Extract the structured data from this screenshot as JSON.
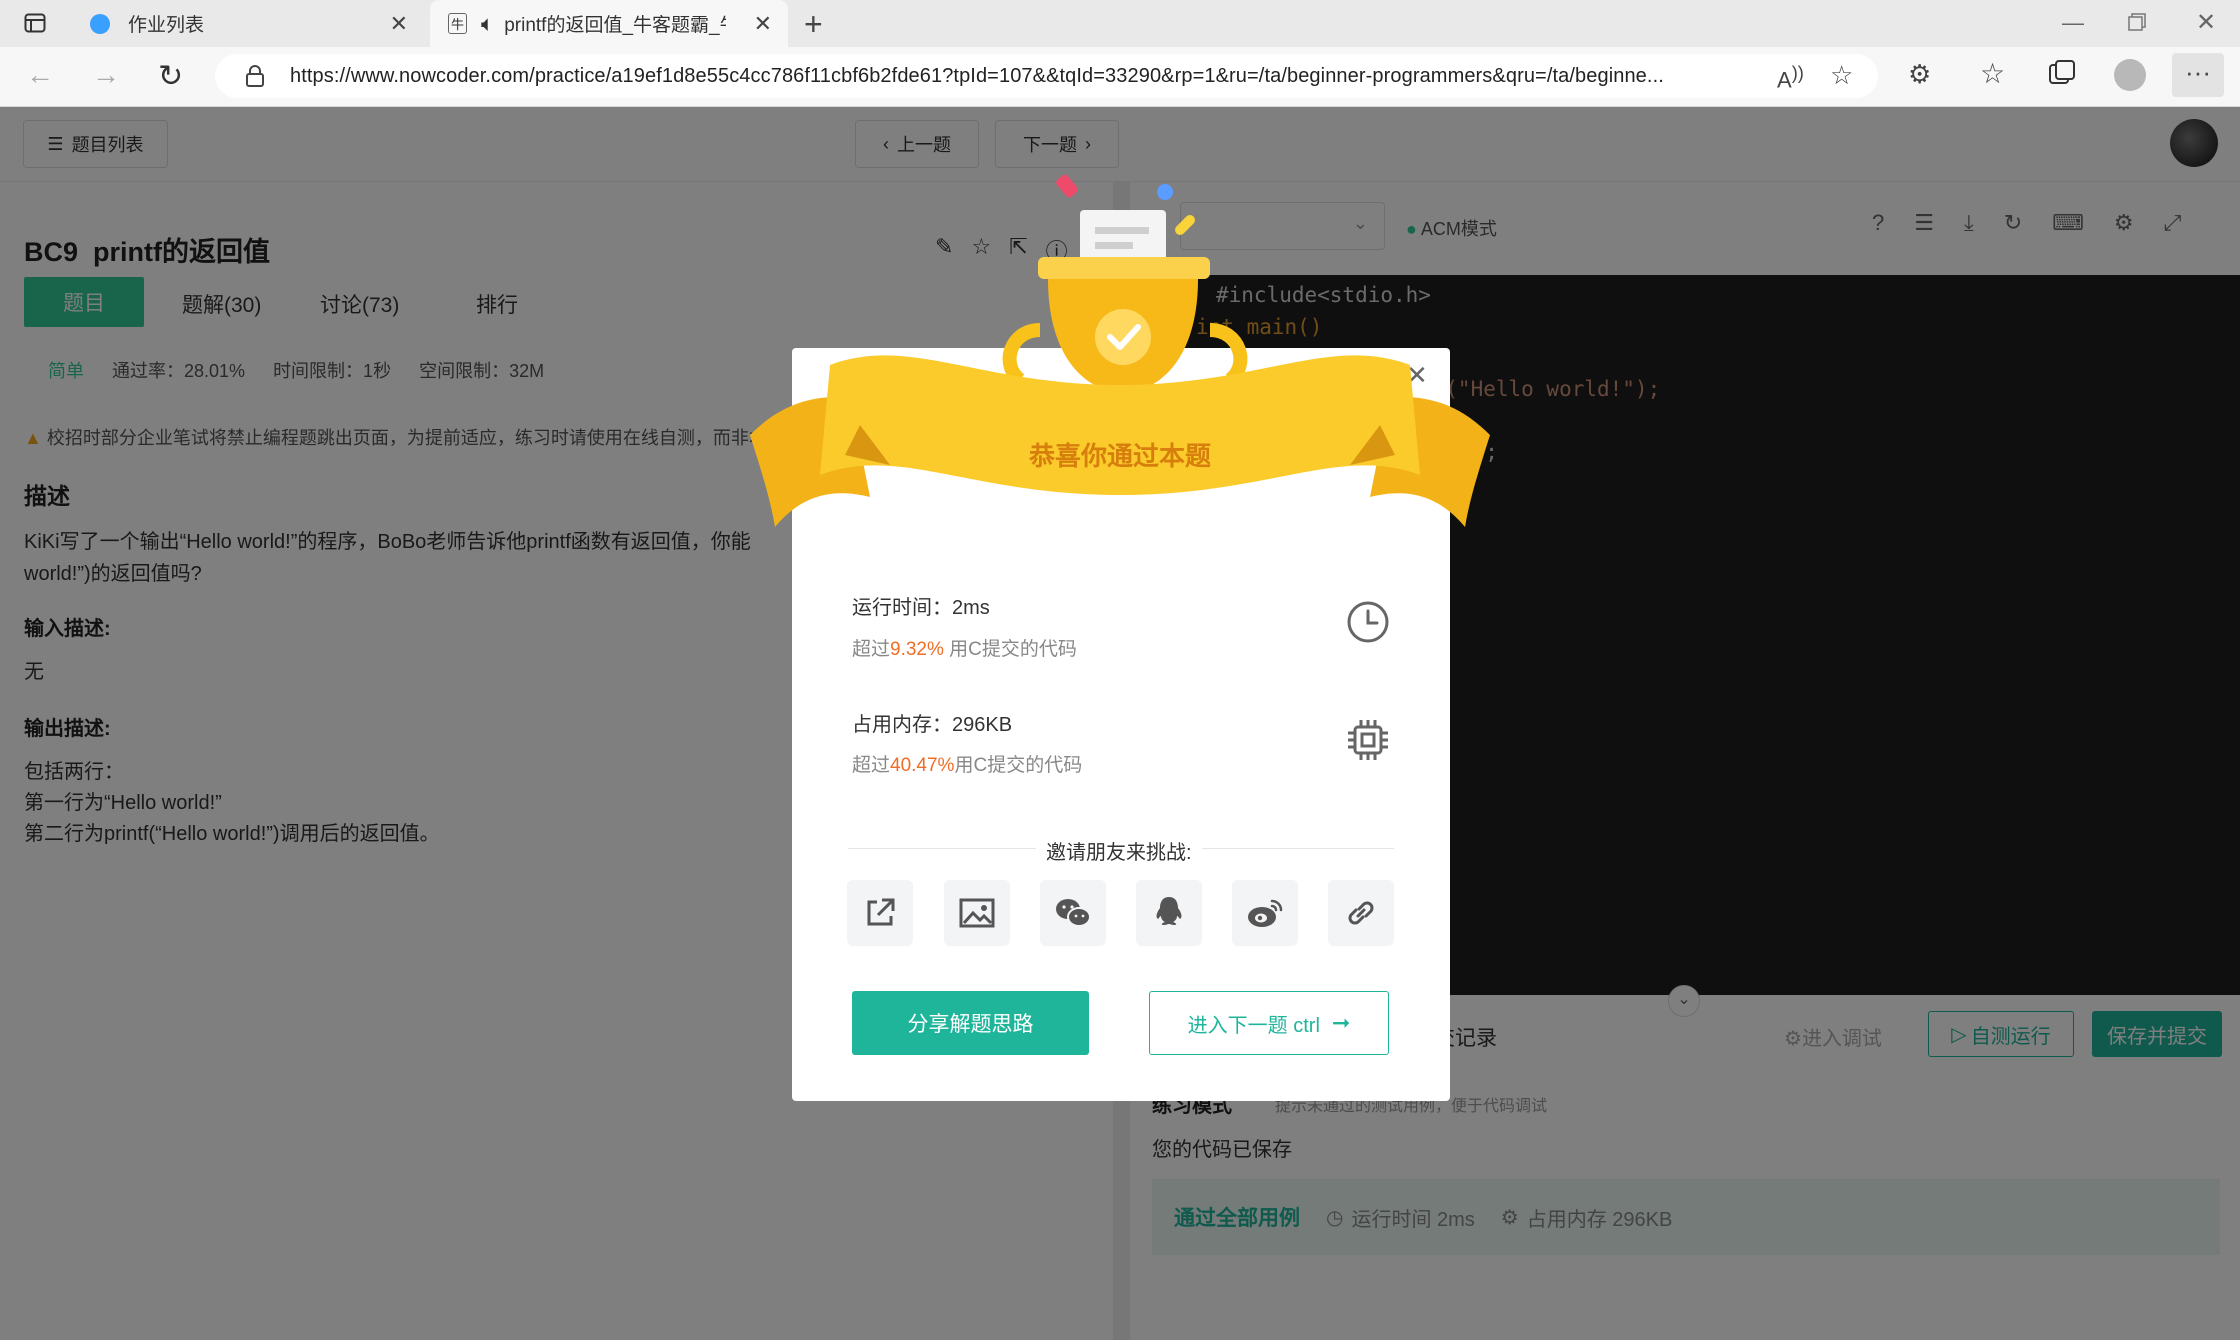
{
  "browser": {
    "tabs": [
      {
        "title": "作业列表",
        "active": false
      },
      {
        "title": "printf的返回值_牛客题霸_牛",
        "active": true
      }
    ],
    "url": "https://www.nowcoder.com/practice/a19ef1d8e55c4cc786f11cbf6b2fde61?tpId=107&&tqId=33290&rp=1&ru=/ta/beginner-programmers&qru=/ta/beginne..."
  },
  "nav": {
    "list_label": "题目列表",
    "prev_label": "上一题",
    "next_label": "下一题"
  },
  "problem": {
    "title": "BC9  printf的返回值",
    "tabs": [
      "题目",
      "题解(30)",
      "讨论(73)",
      "排行"
    ],
    "difficulty": "简单",
    "pass_rate": "通过率：28.01%",
    "time_limit": "时间限制：1秒",
    "space_limit": "空间限制：32M",
    "notice": "校招时部分企业笔试将禁止编程题跳出页面，为提前适应，练习时请使用在线自测，而非本地",
    "desc_heading": "描述",
    "desc_line1": "KiKi写了一个输出“Hello world!”的程序，BoBo老师告诉他printf函数有返回值，你能",
    "desc_line2": "world!”)的返回值吗?",
    "input_heading": "输入描述:",
    "input_text": "无",
    "output_heading": "输出描述:",
    "output_lines": [
      "包括两行：",
      "第一行为“Hello world!”",
      "第二行为printf(“Hello world!”)调用后的返回值。"
    ]
  },
  "editor": {
    "mode": "ACM模式",
    "lines": [
      "#include<stdio.h>",
      "int main()",
      "tf(\"Hello world!\");",
      "a);"
    ]
  },
  "bottom": {
    "records_tab": "交记录",
    "debug": "进入调试",
    "self_test": "自测运行",
    "submit": "保存并提交",
    "practice_mode": "练习模式",
    "practice_hint": "提示未通过的测试用例，便于代码调试",
    "saved": "您的代码已保存",
    "result": "通过全部用例",
    "run_time": "运行时间 2ms",
    "memory": "占用内存 296KB"
  },
  "modal": {
    "banner": "恭喜你通过本题",
    "run_time_label": "运行时间：2ms",
    "run_time_prefix": "超过",
    "run_time_pct": "9.32%",
    "run_time_suffix": " 用C提交的代码",
    "memory_label": "占用内存：296KB",
    "memory_prefix": "超过",
    "memory_pct": "40.47%",
    "memory_suffix": "用C提交的代码",
    "invite": "邀请朋友来挑战:",
    "share_btn": "分享解题思路",
    "next_btn": "进入下一题 ctrl"
  },
  "colors": {
    "brand_green": "#32ca99",
    "teal": "#1fb59b",
    "orange": "#f06d27",
    "gold": "#f8c21a"
  }
}
